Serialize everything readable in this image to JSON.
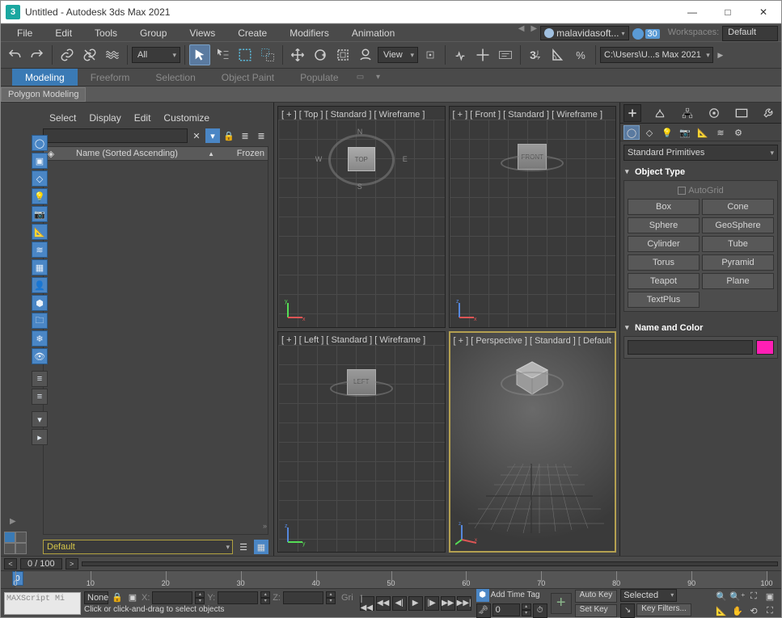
{
  "titlebar": {
    "app_icon_letter": "3",
    "title": "Untitled - Autodesk 3ds Max 2021"
  },
  "menubar": {
    "items": [
      "File",
      "Edit",
      "Tools",
      "Group",
      "Views",
      "Create",
      "Modifiers",
      "Animation"
    ],
    "user": "malavidasoft...",
    "time": "30",
    "workspaces_label": "Workspaces:",
    "workspaces_value": "Default"
  },
  "maintb": {
    "sel_filter": "All",
    "view_label": "View",
    "path_value": "C:\\Users\\U...s Max 2021"
  },
  "ribbon": {
    "tabs": [
      "Modeling",
      "Freeform",
      "Selection",
      "Object Paint",
      "Populate"
    ],
    "active": "Modeling",
    "subtab": "Polygon Modeling"
  },
  "explorer": {
    "menus": [
      "Select",
      "Display",
      "Edit",
      "Customize"
    ],
    "header_col1": "Name (Sorted Ascending)",
    "header_arrow": "▲",
    "header_col2": "Frozen",
    "layer_value": "Default"
  },
  "viewports": {
    "top": {
      "label": "[ + ] [ Top ] [ Standard ] [ Wireframe ]",
      "cube": "TOP",
      "compass_n": "N",
      "compass_e": "E",
      "compass_s": "S",
      "compass_w": "W"
    },
    "front": {
      "label": "[ + ] [ Front ] [ Standard ] [ Wireframe ]",
      "cube": "FRONT"
    },
    "left": {
      "label": "[ + ] [ Left ] [ Standard ] [ Wireframe ]",
      "cube": "LEFT"
    },
    "persp": {
      "label": "[ + ] [ Perspective ] [ Standard ] [ Default",
      "cube": ""
    }
  },
  "cmdpanel": {
    "category": "Standard Primitives",
    "rollout1": "Object Type",
    "autogrid": "AutoGrid",
    "buttons": [
      "Box",
      "Cone",
      "Sphere",
      "GeoSphere",
      "Cylinder",
      "Tube",
      "Torus",
      "Pyramid",
      "Teapot",
      "Plane",
      "TextPlus"
    ],
    "rollout2": "Name and Color",
    "color": "#ff1fb5"
  },
  "timeline": {
    "range": "0 / 100",
    "ticks": [
      0,
      10,
      20,
      30,
      40,
      50,
      60,
      70,
      80,
      90,
      100
    ],
    "current": "0"
  },
  "status": {
    "maxscript": "MAXScript Mi",
    "none": "None",
    "x_label": "X:",
    "x_val": "",
    "y_label": "Y:",
    "y_val": "",
    "z_label": "Z:",
    "z_val": "",
    "grid_label": "Gri",
    "prompt": "Click or click-and-drag to select objects",
    "add_time_tag": "Add Time Tag",
    "frame_val": "0",
    "auto_key": "Auto Key",
    "set_key": "Set Key",
    "selected": "Selected",
    "key_filters": "Key Filters..."
  }
}
